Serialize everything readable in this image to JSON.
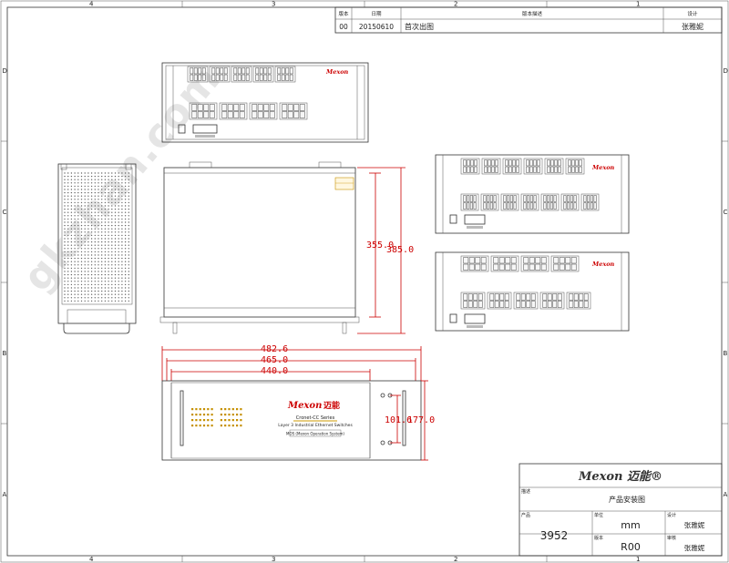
{
  "frame": {
    "top_zones": [
      "4",
      "3",
      "2",
      "1"
    ],
    "bottom_zones": [
      "4",
      "3",
      "2",
      "1"
    ],
    "left_zones": [
      "D",
      "C",
      "B",
      "A"
    ],
    "right_zones": [
      "D",
      "C",
      "B",
      "A"
    ]
  },
  "watermark": "gkzhan.com",
  "revision_table": {
    "headers": [
      "版本",
      "日期",
      "版本描述",
      "设计"
    ],
    "row": [
      "00",
      "20150610",
      "首次出图",
      "张雅妮"
    ]
  },
  "brand": {
    "name": "Mexon",
    "chinese": "迈能",
    "series": "Cronet-CC Series",
    "subtitle": "Layer 3 Industrial Ethernet Switches",
    "os": "MOS (Mexon Operation System)"
  },
  "dimensions": {
    "depth_inner": "355.0",
    "depth_outer": "385.0",
    "width_overall": "482.6",
    "width_ears": "465.0",
    "width_body": "440.0",
    "height_inner": "101.6",
    "height_outer": "177.0"
  },
  "title_block": {
    "logo_text": "Mexon 迈能®",
    "desc_label": "描述",
    "description": "产品安装图",
    "product_label": "产品",
    "product": "3952",
    "unit_label": "单位",
    "unit": "mm",
    "version_label": "版本",
    "version": "R00",
    "design_label": "设计",
    "designer": "张雅妮",
    "review_label": "审核",
    "reviewer": "张雅妮"
  }
}
